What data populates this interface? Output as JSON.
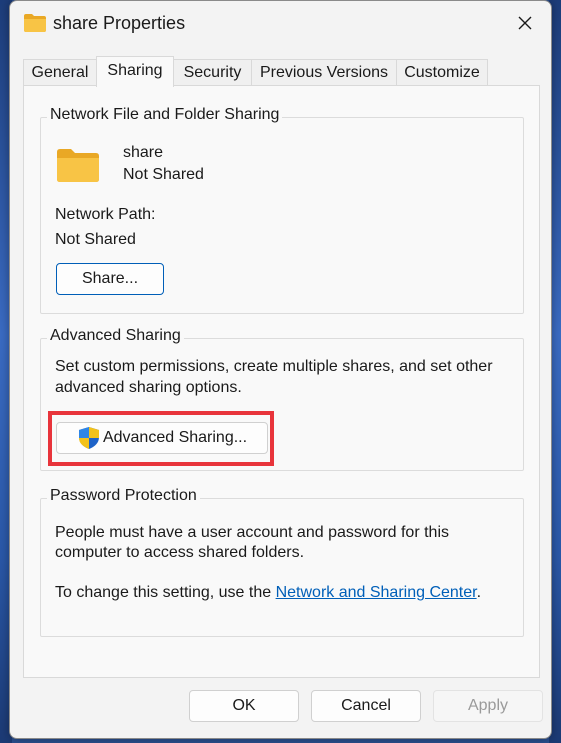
{
  "window": {
    "title": "share Properties",
    "close_icon": "close-icon"
  },
  "tabs": [
    {
      "label": "General"
    },
    {
      "label": "Sharing"
    },
    {
      "label": "Security"
    },
    {
      "label": "Previous Versions"
    },
    {
      "label": "Customize"
    }
  ],
  "active_tab": "Sharing",
  "network_sharing": {
    "title": "Network File and Folder Sharing",
    "folder_name": "share",
    "status": "Not Shared",
    "path_label": "Network Path:",
    "path_value": "Not Shared",
    "share_button": "Share..."
  },
  "advanced_sharing": {
    "title": "Advanced Sharing",
    "description_line1": "Set custom permissions, create multiple shares, and set other",
    "description_line2": "advanced sharing options.",
    "button": "Advanced Sharing..."
  },
  "password_protection": {
    "title": "Password Protection",
    "description_line1": "People must have a user account and password for this",
    "description_line2": "computer to access shared folders.",
    "change_prefix": "To change this setting, use the ",
    "link_text": "Network and Sharing Center",
    "change_suffix": "."
  },
  "footer": {
    "ok": "OK",
    "cancel": "Cancel",
    "apply": "Apply"
  },
  "colors": {
    "accent": "#005fb8",
    "highlight_box": "#e8343b",
    "folder": "#f8c445"
  }
}
